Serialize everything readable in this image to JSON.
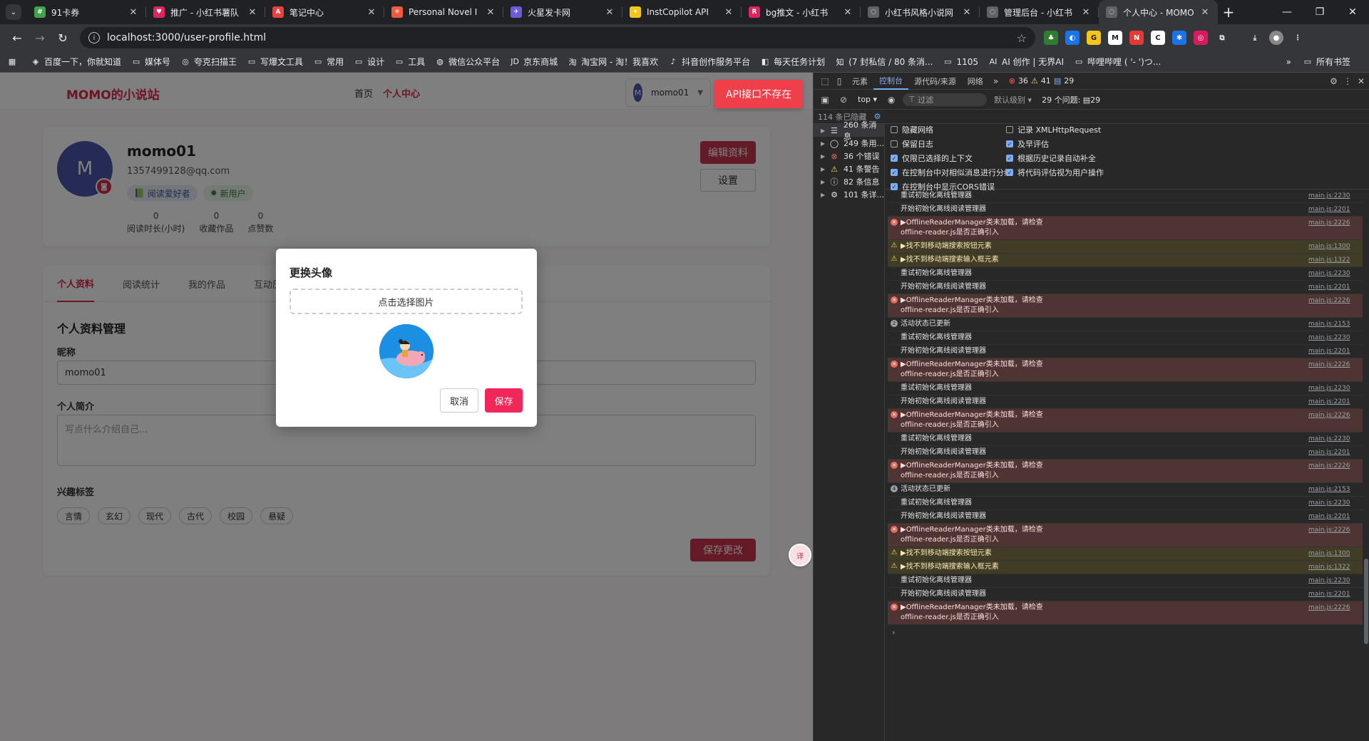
{
  "browser": {
    "tabs": [
      {
        "title": "91卡券",
        "color": "#3fa34d",
        "active": false
      },
      {
        "title": "推广 - 小红书薯队",
        "color": "#e0245e",
        "active": false
      },
      {
        "title": "笔记中心",
        "color": "#e8413d",
        "active": false
      },
      {
        "title": "Personal Novel I",
        "color": "#ef5a3c",
        "active": false
      },
      {
        "title": "火星发卡网",
        "color": "#6b5bd6",
        "active": false
      },
      {
        "title": "InstCopilot API",
        "color": "#f5c518",
        "active": false
      },
      {
        "title": "bg推文 - 小红书",
        "color": "#e0245e",
        "active": false
      },
      {
        "title": "小红书风格小说网",
        "color": "#5f6368",
        "active": false
      },
      {
        "title": "管理后台 - 小红书",
        "color": "#5f6368",
        "active": false
      },
      {
        "title": "个人中心 - MOMO",
        "color": "#5f6368",
        "active": true
      }
    ],
    "url": "localhost:3000/user-profile.html",
    "bookmarks": [
      "百度一下，你就知道",
      "媒体号",
      "夸克扫描王",
      "写爆文工具",
      "常用",
      "设计",
      "工具",
      "微信公众平台",
      "京东商城",
      "淘宝网 - 淘！我喜欢",
      "抖音创作服务平台",
      "每天任务计划",
      "(7 封私信 / 80 条消...",
      "1105",
      "AI 创作 | 无界AI",
      "哔哩哔哩 ( '- ')つ..."
    ],
    "bookmarks_overflow": "»",
    "all_bookmarks": "所有书签"
  },
  "site": {
    "logo": "MOMO的小说站",
    "nav": [
      "首页",
      "个人中心"
    ],
    "user_name": "momo01",
    "user_initial": "M",
    "api_error": "API接口不存在"
  },
  "profile": {
    "initial": "M",
    "name": "momo01",
    "email": "1357499128@qq.com",
    "badges": [
      "阅读爱好者",
      "新用户"
    ],
    "stats": [
      {
        "value": "0",
        "label": "阅读时长(小时)"
      },
      {
        "value": "0",
        "label": "收藏作品"
      },
      {
        "value": "0",
        "label": "点赞数"
      }
    ],
    "edit_label": "编辑资料",
    "settings_label": "设置"
  },
  "tabs": [
    "个人资料",
    "阅读统计",
    "我的作品",
    "互动历史"
  ],
  "form": {
    "section_title": "个人资料管理",
    "nickname_label": "昵称",
    "nickname_value": "momo01",
    "bio_label": "个人简介",
    "bio_placeholder": "写点什么介绍自己...",
    "tags_label": "兴趣标签",
    "tags": [
      "言情",
      "玄幻",
      "现代",
      "古代",
      "校园",
      "悬疑"
    ],
    "save_label": "保存更改"
  },
  "modal": {
    "title": "更换头像",
    "pick_label": "点击选择图片",
    "cancel_label": "取消",
    "save_label": "保存"
  },
  "devtools": {
    "tabs": [
      "元素",
      "控制台",
      "源代码/来源",
      "网络"
    ],
    "error_count": "36",
    "warn_count": "41",
    "msg_count": "29",
    "context": "top",
    "filter_placeholder": "过滤",
    "level": "默认级别",
    "issues": "29 个问题:",
    "issues_count": "29",
    "hidden": "114 条已隐藏",
    "side": [
      {
        "label": "260 条消息"
      },
      {
        "label": "249 条用..."
      },
      {
        "label": "36 个错误"
      },
      {
        "label": "41 条警告"
      },
      {
        "label": "82 条信息"
      },
      {
        "label": "101 条详..."
      }
    ],
    "settings": [
      {
        "label": "隐藏网络",
        "on": false
      },
      {
        "label": "记录 XMLHttpRequest",
        "on": false
      },
      {
        "label": "保留日志",
        "on": false
      },
      {
        "label": "及早评估",
        "on": true
      },
      {
        "label": "仅限已选择的上下文",
        "on": true
      },
      {
        "label": "根据历史记录自动补全",
        "on": true
      },
      {
        "label": "在控制台中对相似消息进行分组",
        "on": true
      },
      {
        "label": "将代码评估视为用户操作",
        "on": true
      },
      {
        "label": "在控制台中显示CORS错误",
        "on": true
      }
    ],
    "logs": [
      {
        "type": "plain",
        "msg": "重试初始化离线管理器",
        "src": "main.js:2230"
      },
      {
        "type": "plain",
        "msg": "开始初始化离线阅读管理器",
        "src": "main.js:2201"
      },
      {
        "type": "err",
        "msg": "▶OfflineReaderManager类未加载，请检查\noffline-reader.js是否正确引入",
        "src": "main.js:2226"
      },
      {
        "type": "warn",
        "msg": "▶找不到移动端搜索按钮元素",
        "src": "main.js:1300"
      },
      {
        "type": "warn",
        "msg": "▶找不到移动端搜索输入框元素",
        "src": "main.js:1322"
      },
      {
        "type": "plain",
        "msg": "重试初始化离线管理器",
        "src": "main.js:2230"
      },
      {
        "type": "plain",
        "msg": "开始初始化离线阅读管理器",
        "src": "main.js:2201"
      },
      {
        "type": "err",
        "msg": "▶OfflineReaderManager类未加载，请检查\noffline-reader.js是否正确引入",
        "src": "main.js:2226"
      },
      {
        "type": "info",
        "msg": "活动状态已更新",
        "src": "main.js:2153",
        "count": "2"
      },
      {
        "type": "plain",
        "msg": "重试初始化离线管理器",
        "src": "main.js:2230"
      },
      {
        "type": "plain",
        "msg": "开始初始化离线阅读管理器",
        "src": "main.js:2201"
      },
      {
        "type": "err",
        "msg": "▶OfflineReaderManager类未加载，请检查\noffline-reader.js是否正确引入",
        "src": "main.js:2226"
      },
      {
        "type": "plain",
        "msg": "重试初始化离线管理器",
        "src": "main.js:2230"
      },
      {
        "type": "plain",
        "msg": "开始初始化离线阅读管理器",
        "src": "main.js:2201"
      },
      {
        "type": "err",
        "msg": "▶OfflineReaderManager类未加载，请检查\noffline-reader.js是否正确引入",
        "src": "main.js:2226"
      },
      {
        "type": "plain",
        "msg": "重试初始化离线管理器",
        "src": "main.js:2230"
      },
      {
        "type": "plain",
        "msg": "开始初始化离线阅读管理器",
        "src": "main.js:2201"
      },
      {
        "type": "err",
        "msg": "▶OfflineReaderManager类未加载，请检查\noffline-reader.js是否正确引入",
        "src": "main.js:2226"
      },
      {
        "type": "info",
        "msg": "活动状态已更新",
        "src": "main.js:2153",
        "count": "4"
      },
      {
        "type": "plain",
        "msg": "重试初始化离线管理器",
        "src": "main.js:2230"
      },
      {
        "type": "plain",
        "msg": "开始初始化离线阅读管理器",
        "src": "main.js:2201"
      },
      {
        "type": "err",
        "msg": "▶OfflineReaderManager类未加载，请检查\noffline-reader.js是否正确引入",
        "src": "main.js:2226"
      },
      {
        "type": "warn",
        "msg": "▶找不到移动端搜索按钮元素",
        "src": "main.js:1300"
      },
      {
        "type": "warn",
        "msg": "▶找不到移动端搜索输入框元素",
        "src": "main.js:1322"
      },
      {
        "type": "plain",
        "msg": "重试初始化离线管理器",
        "src": "main.js:2230"
      },
      {
        "type": "plain",
        "msg": "开始初始化离线阅读管理器",
        "src": "main.js:2201"
      },
      {
        "type": "err",
        "msg": "▶OfflineReaderManager类未加载，请检查\noffline-reader.js是否正确引入",
        "src": "main.js:2226"
      }
    ]
  }
}
